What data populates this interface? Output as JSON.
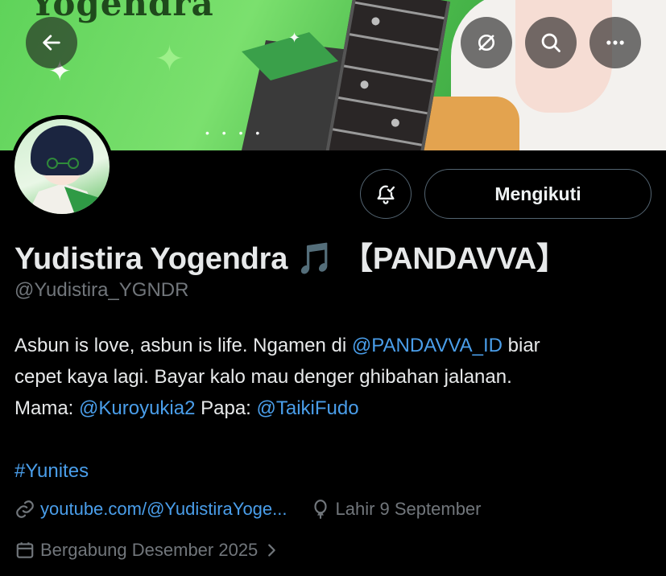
{
  "banner": {
    "logo_text": "Yogendra"
  },
  "header": {
    "back_icon": "arrow-left-icon",
    "grok_icon": "grok-icon",
    "search_icon": "search-icon",
    "more_icon": "more-horizontal-icon"
  },
  "actions": {
    "notify_icon": "bell-check-icon",
    "follow_label": "Mengikuti"
  },
  "profile": {
    "display_name": "Yudistira Yogendra 🎵 【PANDAVVA】",
    "handle": "@Yudistira_YGNDR"
  },
  "bio": {
    "line1_pre": "Asbun is love, asbun is life. Ngamen di ",
    "mention_pandavva": "@PANDAVVA_ID",
    "line1_post": " biar",
    "line2": "cepet kaya lagi. Bayar kalo mau denger ghibahan jalanan.",
    "mama_label": "Mama: ",
    "mention_mama": "@Kuroyukia2",
    "papa_label": " Papa: ",
    "mention_papa": "@TaikiFudo",
    "hashtag": "#Yunites"
  },
  "meta": {
    "website": "youtube.com/@YudistiraYoge...",
    "birthday": "Lahir 9 September",
    "joined": "Bergabung Desember 2025"
  },
  "colors": {
    "link": "#4a9eea",
    "muted": "#71767b",
    "background": "#000000"
  }
}
